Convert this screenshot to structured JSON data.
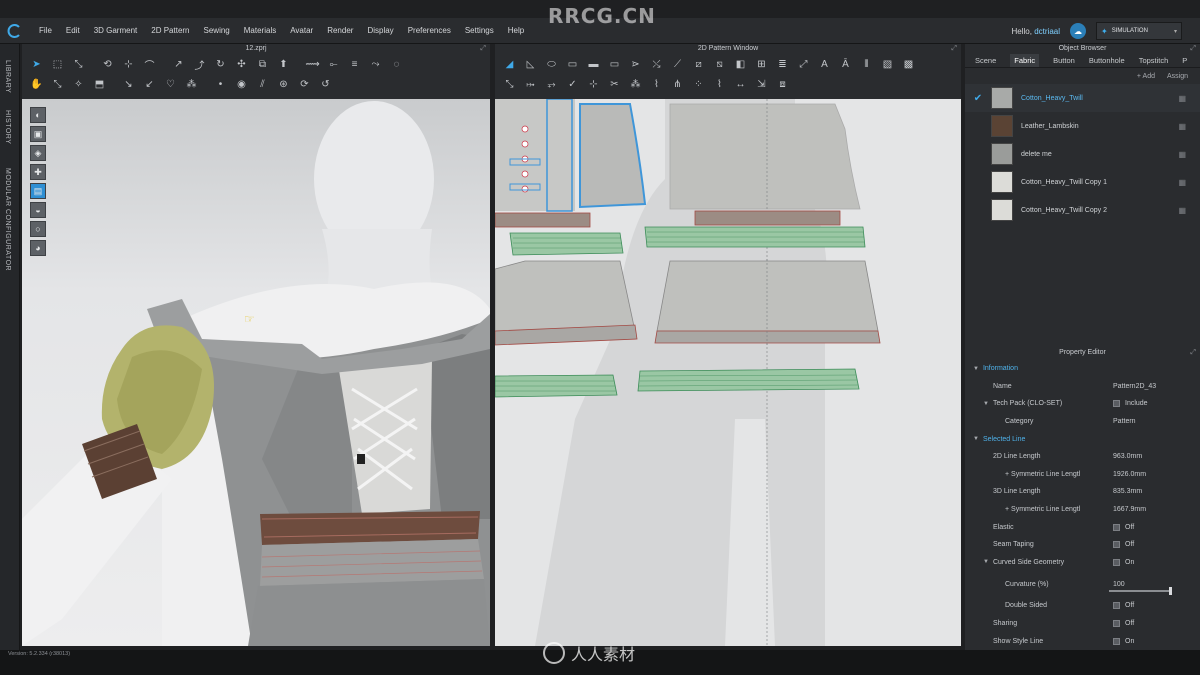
{
  "watermark": {
    "top": "RRCG.CN",
    "bottom": "人人素材"
  },
  "menu": [
    "File",
    "Edit",
    "3D Garment",
    "2D Pattern",
    "Sewing",
    "Materials",
    "Avatar",
    "Render",
    "Display",
    "Preferences",
    "Settings",
    "Help"
  ],
  "user": {
    "greeting": "Hello, ",
    "name": "dctriaal"
  },
  "simulation_label": "SIMULATION",
  "side_tabs": [
    "LIBRARY",
    "HISTORY",
    "MODULAR CONFIGURATOR"
  ],
  "panel3d": {
    "title": "12.zprj"
  },
  "panel2d": {
    "title": "2D Pattern Window"
  },
  "object_browser": {
    "title": "Object Browser",
    "tabs": [
      "Scene",
      "Fabric",
      "Button",
      "Buttonhole",
      "Topstitch",
      "P"
    ],
    "active_tab": "Fabric",
    "actions": [
      "+ Add",
      "Assign"
    ],
    "fabrics": [
      {
        "name": "Cotton_Heavy_Twill",
        "color": "#a8aaa8",
        "selected": true
      },
      {
        "name": "Leather_Lambskin",
        "color": "#5a4334",
        "selected": false
      },
      {
        "name": "delete me",
        "color": "#9a9c9a",
        "selected": false
      },
      {
        "name": "Cotton_Heavy_Twill Copy 1",
        "color": "#dcdcd8",
        "selected": false
      },
      {
        "name": "Cotton_Heavy_Twill Copy 2",
        "color": "#dcdcd8",
        "selected": false
      }
    ]
  },
  "property_editor": {
    "title": "Property Editor",
    "rows": [
      {
        "label": "Information",
        "type": "section",
        "indent": 0,
        "value": ""
      },
      {
        "label": "Name",
        "type": "field",
        "indent": 1,
        "value": "Pattern2D_43"
      },
      {
        "label": "Tech Pack (CLO-SET)",
        "type": "subsection",
        "indent": 1,
        "value": "Include",
        "checkbox": true
      },
      {
        "label": "Category",
        "type": "field",
        "indent": 2,
        "value": "Pattern"
      },
      {
        "label": "Selected Line",
        "type": "section",
        "indent": 0,
        "value": ""
      },
      {
        "label": "2D Line Length",
        "type": "field",
        "indent": 1,
        "value": "963.0mm"
      },
      {
        "label": "+ Symmetric Line Lengtl",
        "type": "field",
        "indent": 2,
        "value": "1926.0mm"
      },
      {
        "label": "3D Line Length",
        "type": "field",
        "indent": 1,
        "value": "835.3mm"
      },
      {
        "label": "+ Symmetric Line Lengtl",
        "type": "field",
        "indent": 2,
        "value": "1667.9mm"
      },
      {
        "label": "Elastic",
        "type": "field",
        "indent": 1,
        "value": "Off",
        "checkbox": true
      },
      {
        "label": "Seam Taping",
        "type": "field",
        "indent": 1,
        "value": "Off",
        "checkbox": true
      },
      {
        "label": "Curved Side Geometry",
        "type": "subsection",
        "indent": 1,
        "value": "On",
        "checkbox": true
      },
      {
        "label": "Curvature (%)",
        "type": "field",
        "indent": 2,
        "value": "100"
      },
      {
        "label": "Double Sided",
        "type": "field",
        "indent": 2,
        "value": "Off",
        "checkbox": true
      },
      {
        "label": "Sharing",
        "type": "field",
        "indent": 1,
        "value": "Off",
        "checkbox": true
      },
      {
        "label": "Show Style Line",
        "type": "field",
        "indent": 1,
        "value": "On",
        "checkbox": true
      }
    ],
    "curvature_slider_fraction": 1.0
  },
  "status": "Version: 5.2.334 (r38013)"
}
